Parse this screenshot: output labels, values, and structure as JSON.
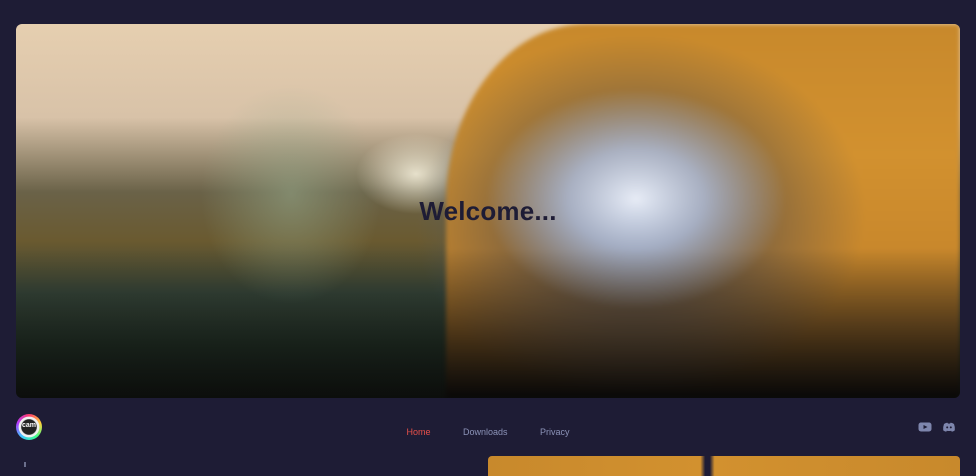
{
  "hero": {
    "title": "Welcome..."
  },
  "nav": {
    "logo_text": "cam",
    "links": [
      {
        "label": "Home",
        "active": true
      },
      {
        "label": "Downloads",
        "active": false
      },
      {
        "label": "Privacy",
        "active": false
      }
    ],
    "social": [
      {
        "icon": "youtube-icon"
      },
      {
        "icon": "discord-icon"
      }
    ]
  },
  "colors": {
    "background": "#1e1c35",
    "active_link": "#e8504a",
    "link": "#8c93b8"
  }
}
